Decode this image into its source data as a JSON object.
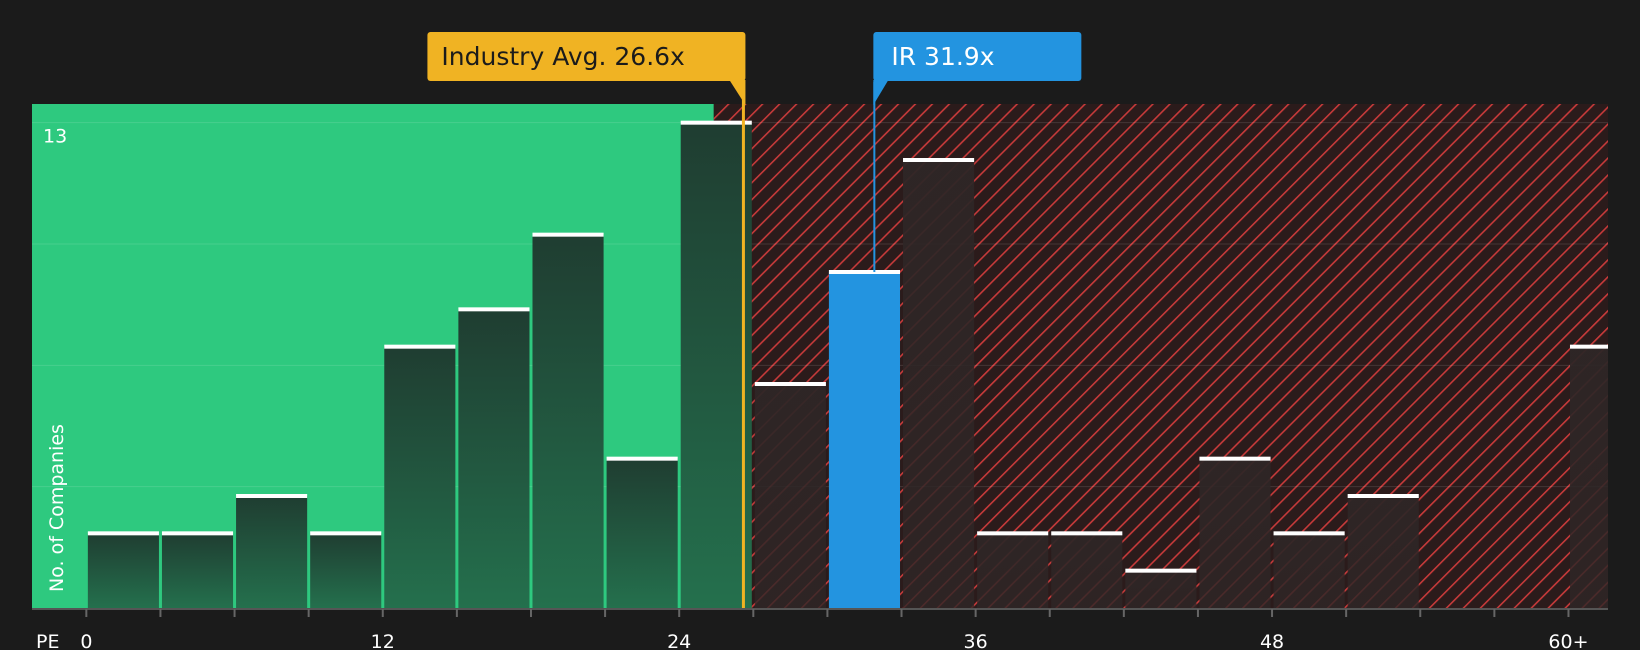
{
  "chart_data": {
    "type": "bar",
    "title": "",
    "xlabel": "PE",
    "ylabel": "No. of Companies",
    "bin_width": 3,
    "bins": [
      {
        "start": 0,
        "value": 2
      },
      {
        "start": 3,
        "value": 2
      },
      {
        "start": 6,
        "value": 3
      },
      {
        "start": 9,
        "value": 2
      },
      {
        "start": 12,
        "value": 7
      },
      {
        "start": 15,
        "value": 8
      },
      {
        "start": 18,
        "value": 10
      },
      {
        "start": 21,
        "value": 4
      },
      {
        "start": 24,
        "value": 13
      },
      {
        "start": 27,
        "value": 6
      },
      {
        "start": 30,
        "value": 9,
        "highlight": true
      },
      {
        "start": 33,
        "value": 12
      },
      {
        "start": 36,
        "value": 2
      },
      {
        "start": 39,
        "value": 2
      },
      {
        "start": 42,
        "value": 1
      },
      {
        "start": 45,
        "value": 4
      },
      {
        "start": 48,
        "value": 2
      },
      {
        "start": 51,
        "value": 3
      },
      {
        "start": 60,
        "value": 7
      }
    ],
    "x_ticks": [
      {
        "value": 0,
        "label": "0"
      },
      {
        "value": 12,
        "label": "12"
      },
      {
        "value": 24,
        "label": "24"
      },
      {
        "value": 36,
        "label": "36"
      },
      {
        "value": 48,
        "label": "48"
      },
      {
        "value": 60,
        "label": "60+"
      }
    ],
    "xlim": [
      -2.2,
      61.6
    ],
    "ylim": [
      0,
      13.5
    ],
    "y_label_value": 13,
    "y_label": "13",
    "gridlines": [
      3.25,
      6.5,
      9.75,
      13
    ],
    "green_zone_end": 25.4,
    "industry_avg": {
      "value": 26.6,
      "label": "Industry Avg. 26.6x",
      "color": "#f0b323"
    },
    "company": {
      "value": 31.9,
      "label": "IR 31.9x",
      "color": "#2394e0"
    },
    "colors": {
      "background": "#1b1b1b",
      "green_zone": "#2ec97f",
      "red_zone": "#2b1b1b",
      "hatch": "#c73a3a",
      "bar_green_top": "#1f3d31",
      "bar_green_bottom": "#24704d",
      "bar_dark": "#2e2626",
      "bar_highlight": "#2394e0"
    }
  }
}
